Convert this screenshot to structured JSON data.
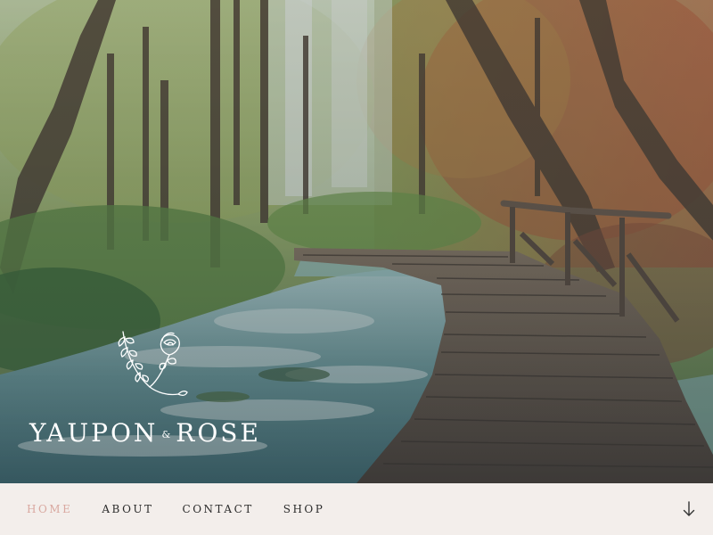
{
  "brand": {
    "name_left": "YAUPON",
    "ampersand": "&",
    "name_right": "ROSE"
  },
  "hero": {
    "image": "forest-stream-boardwalk"
  },
  "nav": {
    "items": [
      {
        "label": "HOME",
        "active": true
      },
      {
        "label": "ABOUT",
        "active": false
      },
      {
        "label": "CONTACT",
        "active": false
      },
      {
        "label": "SHOP",
        "active": false
      }
    ]
  },
  "icons": {
    "scroll": "arrow-down-icon",
    "logo": "rose-branch-icon"
  },
  "colors": {
    "nav_background": "#f3eeeb",
    "nav_active": "#d9a8a0",
    "nav_text": "#2b2b2b",
    "logo_text": "#ffffff"
  }
}
